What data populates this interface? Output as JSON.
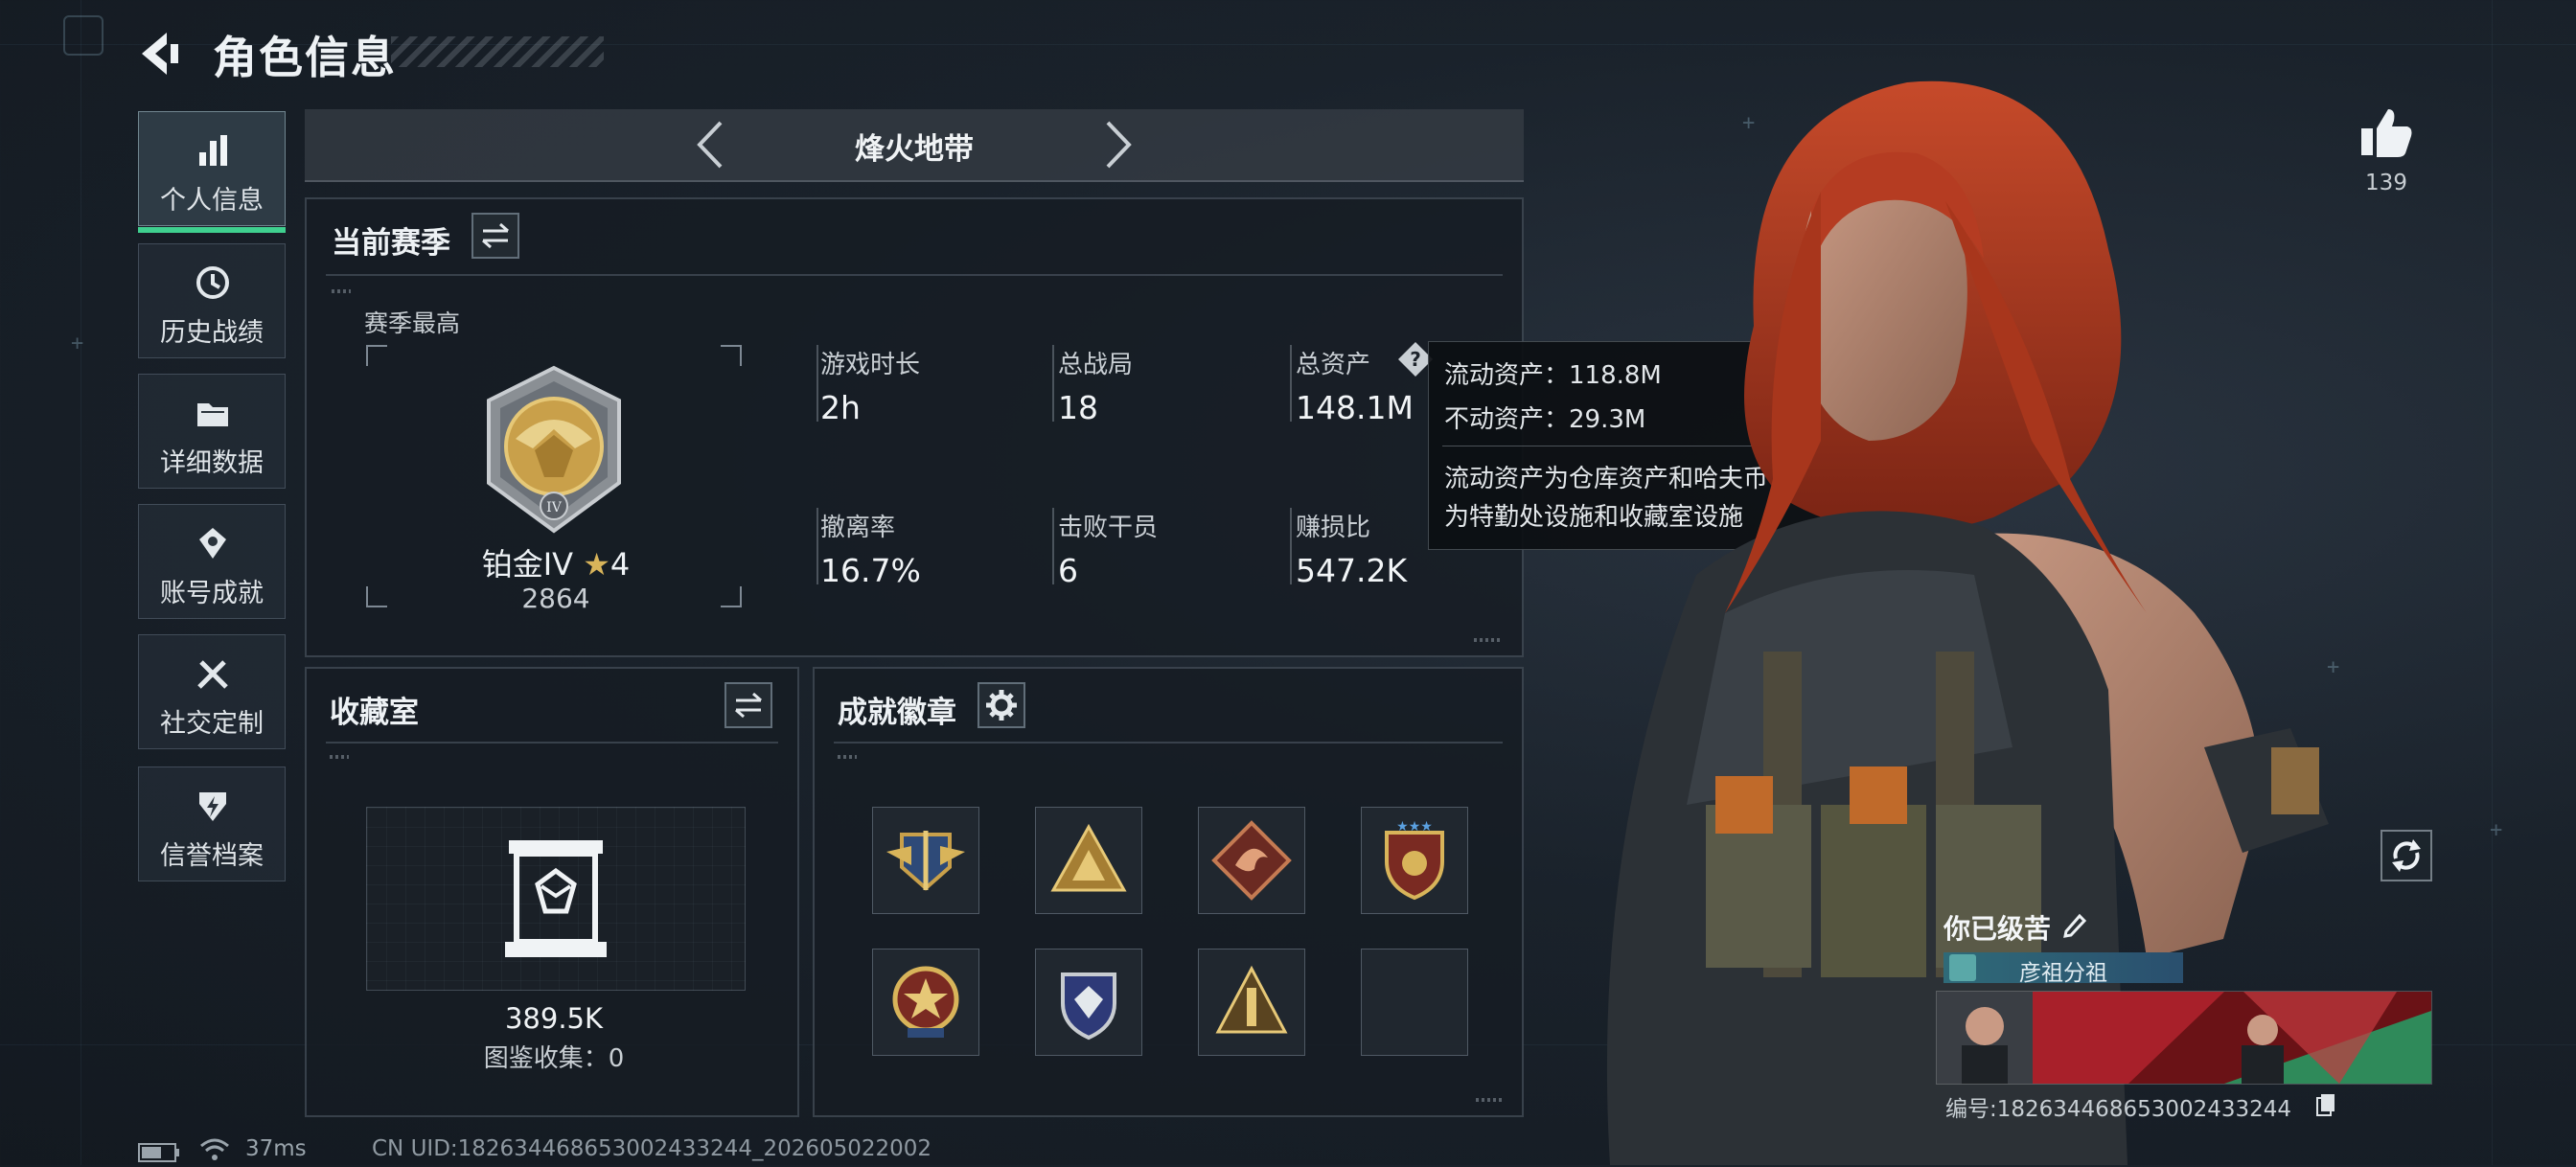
{
  "header": {
    "title": "角色信息",
    "back_icon": "back-arrow-icon"
  },
  "sidebar": {
    "items": [
      {
        "label": "个人信息",
        "icon": "bar-chart-icon",
        "active": true
      },
      {
        "label": "历史战绩",
        "icon": "history-clock-icon",
        "active": false
      },
      {
        "label": "详细数据",
        "icon": "folder-icon",
        "active": false
      },
      {
        "label": "账号成就",
        "icon": "achievement-medal-icon",
        "active": false
      },
      {
        "label": "社交定制",
        "icon": "tools-icon",
        "active": false
      },
      {
        "label": "信誉档案",
        "icon": "shield-bolt-icon",
        "active": false
      }
    ]
  },
  "mode_selector": {
    "current": "烽火地带"
  },
  "season": {
    "title": "当前赛季",
    "best_label": "赛季最高",
    "rank_name": "铂金IV",
    "rank_stars": "4",
    "rank_score": "2864",
    "stats": [
      {
        "label": "游戏时长",
        "value": "2h"
      },
      {
        "label": "总战局",
        "value": "18"
      },
      {
        "label": "总资产",
        "value": "148.1M"
      },
      {
        "label": "撤离率",
        "value": "16.7%"
      },
      {
        "label": "击败干员",
        "value": "6"
      },
      {
        "label": "赚损比",
        "value": "547.2K"
      }
    ]
  },
  "tooltip": {
    "liquid": "流动资产：118.8M",
    "fixed": "不动资产：29.3M",
    "desc_line1": "流动资产为仓库资产和哈夫币，不动资产",
    "desc_line2": "为特勤处设施和收藏室设施"
  },
  "collection": {
    "title": "收藏室",
    "value": "389.5K",
    "catalog": "图鉴收集：0"
  },
  "achievements": {
    "title": "成就徽章",
    "badges": [
      "badge-1",
      "badge-2",
      "badge-3",
      "badge-4",
      "badge-5",
      "badge-6",
      "badge-7",
      "empty"
    ]
  },
  "profile": {
    "likes": "139",
    "name": "你已级苦",
    "group": "彦祖分祖",
    "id": "编号:1826344686530024332​44"
  },
  "status_bar": {
    "ping": "37ms",
    "uid": "CN UID:1826344686530024332​44_202605022002"
  },
  "colors": {
    "accent_green": "#3fd08f",
    "gold": "#c9a04a"
  }
}
